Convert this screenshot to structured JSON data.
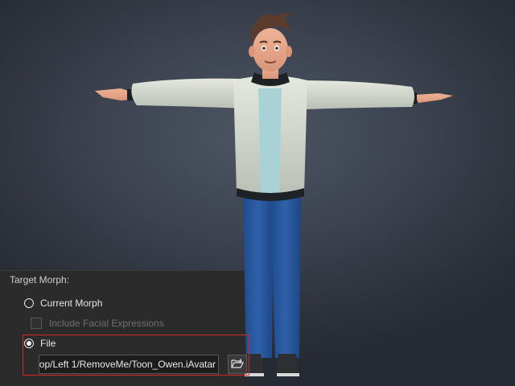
{
  "viewport": {
    "subject": "character-avatar"
  },
  "panel": {
    "section_label": "Target Morph:",
    "options": [
      {
        "label": "Current Morph",
        "selected": false
      },
      {
        "label": "File",
        "selected": true
      }
    ],
    "include_facial_expressions": {
      "label": "Include Facial Expressions",
      "checked": false,
      "enabled": false
    },
    "file_path": "op/Left 1/RemoveMe/Toon_Owen.iAvatar",
    "browse_icon": "folder-open-icon"
  },
  "colors": {
    "highlight": "#d42a2a",
    "panel_bg": "#2b2b2b"
  }
}
